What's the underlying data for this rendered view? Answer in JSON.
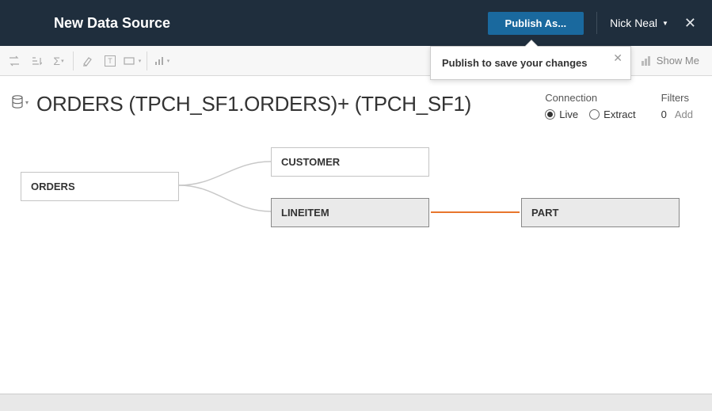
{
  "header": {
    "title": "New Data Source",
    "publish_label": "Publish As...",
    "user_name": "Nick Neal"
  },
  "tooltip": {
    "text": "Publish to save your changes"
  },
  "toolbar": {
    "showme_label": "Show Me"
  },
  "datasource": {
    "title": "ORDERS (TPCH_SF1.ORDERS)+ (TPCH_SF1)"
  },
  "connection": {
    "label": "Connection",
    "live_label": "Live",
    "extract_label": "Extract",
    "selected": "live"
  },
  "filters": {
    "label": "Filters",
    "count": "0",
    "add_label": "Add"
  },
  "canvas": {
    "tables": {
      "orders": "ORDERS",
      "customer": "CUSTOMER",
      "lineitem": "LINEITEM",
      "part": "PART"
    }
  }
}
